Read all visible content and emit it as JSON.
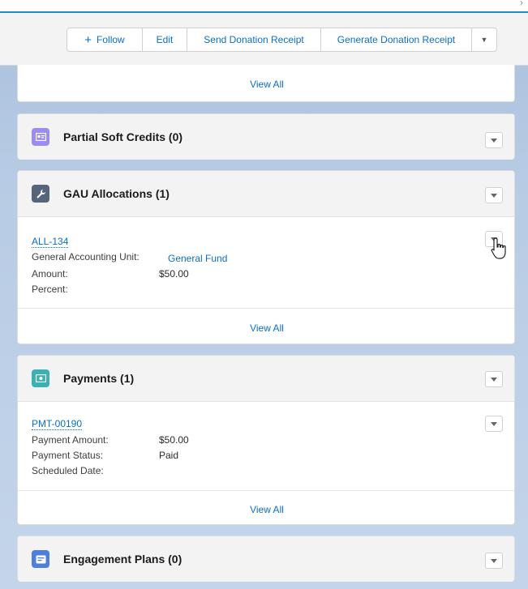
{
  "header": {
    "follow_label": "Follow",
    "edit_label": "Edit",
    "send_receipt_label": "Send Donation Receipt",
    "generate_receipt_label": "Generate Donation Receipt"
  },
  "top_card": {
    "view_all": "View All"
  },
  "partial_soft_credits": {
    "title": "Partial Soft Credits (0)",
    "icon_color": "#9b8cf0"
  },
  "gau_allocations": {
    "title": "GAU Allocations (1)",
    "icon_color": "#56657a",
    "record": {
      "name": "ALL-134",
      "fields": [
        {
          "label": "General Accounting Unit:",
          "value": "General Fund"
        },
        {
          "label": "Amount:",
          "value": "$50.00"
        },
        {
          "label": "Percent:",
          "value": ""
        }
      ]
    },
    "view_all": "View All"
  },
  "payments": {
    "title": "Payments (1)",
    "icon_color": "#3bb1b4",
    "record": {
      "name": "PMT-00190",
      "fields": [
        {
          "label": "Payment Amount:",
          "value": "$50.00"
        },
        {
          "label": "Payment Status:",
          "value": "Paid"
        },
        {
          "label": "Scheduled Date:",
          "value": ""
        }
      ]
    },
    "view_all": "View All"
  },
  "engagement_plans": {
    "title": "Engagement Plans (0)",
    "icon_color": "#4f7fd9"
  }
}
